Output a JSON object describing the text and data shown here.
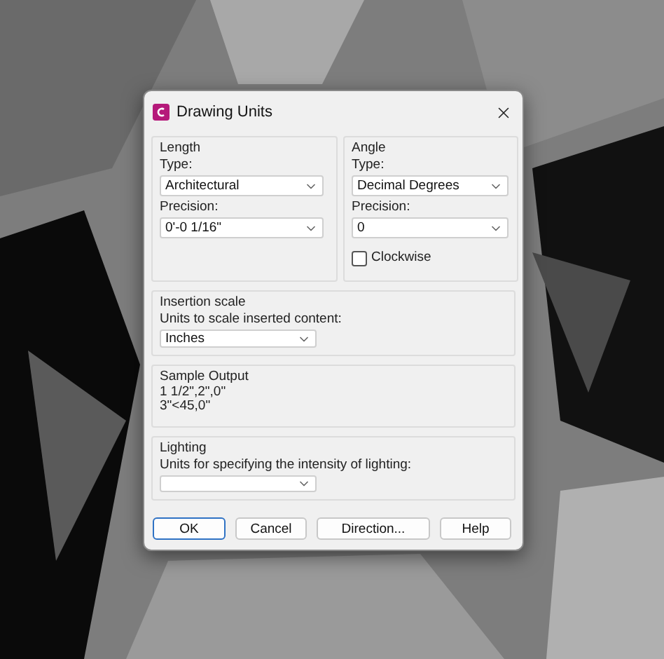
{
  "window": {
    "title": "Drawing Units"
  },
  "length": {
    "label": "Length",
    "type_label": "Type:",
    "type_value": "Architectural",
    "precision_label": "Precision:",
    "precision_value": "0'-0 1/16\""
  },
  "angle": {
    "label": "Angle",
    "type_label": "Type:",
    "type_value": "Decimal Degrees",
    "precision_label": "Precision:",
    "precision_value": "0",
    "clockwise_label": "Clockwise",
    "clockwise": false
  },
  "insertion_scale": {
    "label": "Insertion scale",
    "prompt": "Units to scale inserted content:",
    "value": "Inches"
  },
  "sample_output": {
    "label": "Sample Output",
    "lines": [
      "1 1/2\",2\",0\"",
      "3\"<45,0\""
    ]
  },
  "lighting": {
    "label": "Lighting",
    "prompt": "Units for specifying the intensity of lighting:"
  },
  "buttons": [
    {
      "label": "OK",
      "default": true
    },
    {
      "label": "Cancel",
      "default": false
    },
    {
      "label": "Direction...",
      "default": false
    },
    {
      "label": "Help",
      "default": false
    }
  ]
}
